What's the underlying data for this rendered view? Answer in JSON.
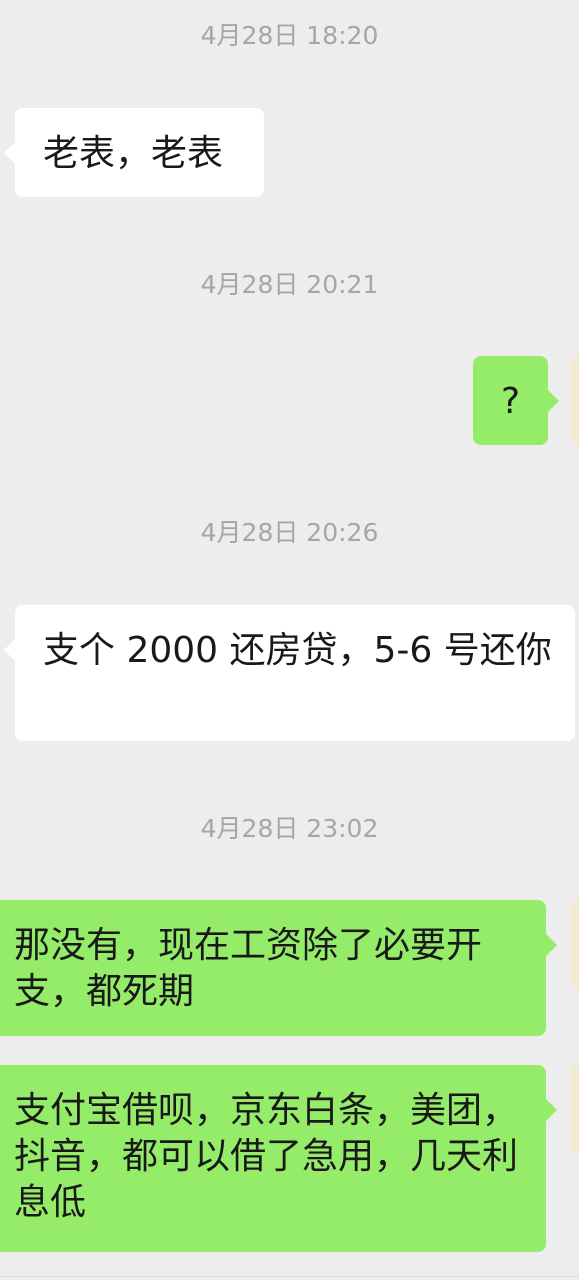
{
  "chat": {
    "messages": [
      {
        "type": "timestamp",
        "text": "4月28日 18:20"
      },
      {
        "type": "message",
        "direction": "incoming",
        "text": "老表，老表"
      },
      {
        "type": "timestamp",
        "text": "4月28日 20:21"
      },
      {
        "type": "message",
        "direction": "outgoing",
        "text": "?"
      },
      {
        "type": "timestamp",
        "text": "4月28日 20:26"
      },
      {
        "type": "message",
        "direction": "incoming",
        "text": "支个 2000 还房贷，5-6 号还你"
      },
      {
        "type": "timestamp",
        "text": "4月28日 23:02"
      },
      {
        "type": "message",
        "direction": "outgoing",
        "text": "那没有，现在工资除了必要开支，都死期"
      },
      {
        "type": "message",
        "direction": "outgoing",
        "text": "支付宝借呗，京东白条，美团，抖音，都可以借了急用，几天利息低"
      }
    ]
  },
  "colors": {
    "background": "#ededed",
    "incoming_bubble": "#ffffff",
    "outgoing_bubble": "#95ec69",
    "timestamp_text": "#a6a6a6"
  }
}
